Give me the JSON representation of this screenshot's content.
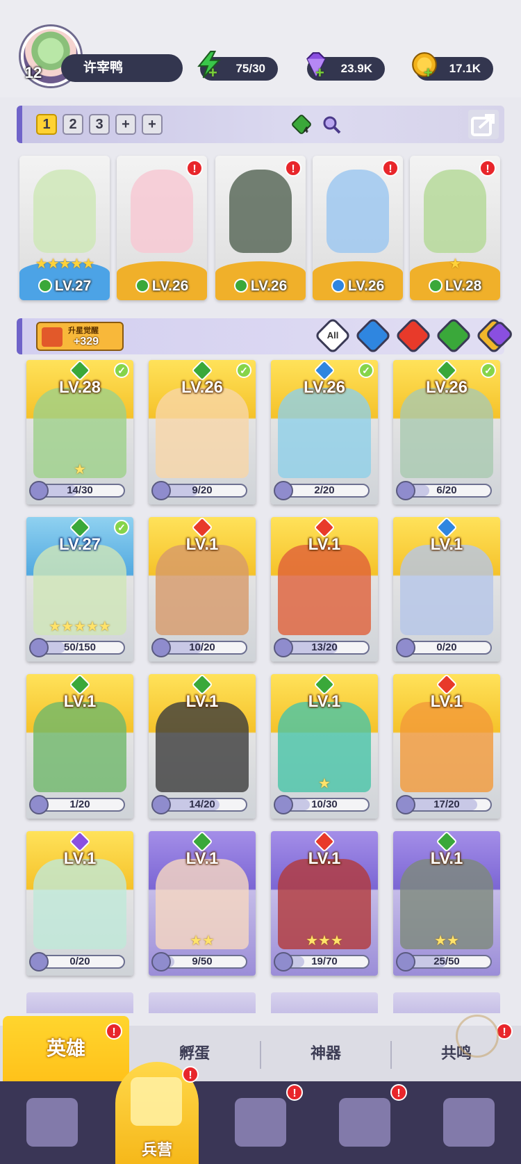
{
  "player": {
    "level": "12",
    "name": "许宰鸭"
  },
  "resources": [
    {
      "name": "energy",
      "icon": "lightning-icon",
      "value": "75/30",
      "color": "#3ac84a"
    },
    {
      "name": "gems",
      "icon": "diamond-icon",
      "value": "23.9K",
      "color": "#8a4fe0"
    },
    {
      "name": "gold",
      "icon": "coin-icon",
      "value": "17.1K",
      "color": "#f2b21c"
    }
  ],
  "team_bar": {
    "slots": [
      "1",
      "2",
      "3",
      "+",
      "+"
    ],
    "gem_count": "4"
  },
  "team": [
    {
      "level": "LV.27",
      "element_color": "#3aa83a",
      "stars": "★★★★★",
      "base": "blue",
      "alert": false
    },
    {
      "level": "LV.26",
      "element_color": "#3aa83a",
      "stars": "",
      "base": "gold",
      "alert": true
    },
    {
      "level": "LV.26",
      "element_color": "#3aa83a",
      "stars": "",
      "base": "gold",
      "alert": true
    },
    {
      "level": "LV.26",
      "element_color": "#2f86e0",
      "stars": "",
      "base": "gold",
      "alert": true
    },
    {
      "level": "LV.28",
      "element_color": "#3aa83a",
      "stars": "★",
      "base": "gold",
      "alert": true
    }
  ],
  "filter": {
    "awaken_label": "升星觉醒",
    "awaken_value": "+329",
    "all_label": "All"
  },
  "heroes": [
    {
      "level": "LV.28",
      "progress": "14/30",
      "elem": "#3aa83a",
      "checked": true,
      "theme": "gold",
      "stars": "★"
    },
    {
      "level": "LV.26",
      "progress": "9/20",
      "elem": "#3aa83a",
      "checked": true,
      "theme": "gold",
      "stars": ""
    },
    {
      "level": "LV.26",
      "progress": "2/20",
      "elem": "#2f86e0",
      "checked": true,
      "theme": "gold",
      "stars": ""
    },
    {
      "level": "LV.26",
      "progress": "6/20",
      "elem": "#3aa83a",
      "checked": true,
      "theme": "gold",
      "stars": ""
    },
    {
      "level": "LV.27",
      "progress": "50/150",
      "elem": "#3aa83a",
      "checked": true,
      "theme": "blue",
      "stars": "★★★★★"
    },
    {
      "level": "LV.1",
      "progress": "10/20",
      "elem": "#e83a2a",
      "checked": false,
      "theme": "gold",
      "stars": ""
    },
    {
      "level": "LV.1",
      "progress": "13/20",
      "elem": "#e83a2a",
      "checked": false,
      "theme": "gold",
      "stars": ""
    },
    {
      "level": "LV.1",
      "progress": "0/20",
      "elem": "#2f86e0",
      "checked": false,
      "theme": "gold",
      "stars": ""
    },
    {
      "level": "LV.1",
      "progress": "1/20",
      "elem": "#3aa83a",
      "checked": false,
      "theme": "gold",
      "stars": ""
    },
    {
      "level": "LV.1",
      "progress": "14/20",
      "elem": "#3aa83a",
      "checked": false,
      "theme": "gold",
      "stars": ""
    },
    {
      "level": "LV.1",
      "progress": "10/30",
      "elem": "#3aa83a",
      "checked": false,
      "theme": "gold",
      "stars": "★"
    },
    {
      "level": "LV.1",
      "progress": "17/20",
      "elem": "#e83a2a",
      "checked": false,
      "theme": "gold",
      "stars": ""
    },
    {
      "level": "LV.1",
      "progress": "0/20",
      "elem": "#8a4fe0",
      "checked": false,
      "theme": "gold",
      "stars": ""
    },
    {
      "level": "LV.1",
      "progress": "9/50",
      "elem": "#3aa83a",
      "checked": false,
      "theme": "purple",
      "stars": "★★"
    },
    {
      "level": "LV.1",
      "progress": "19/70",
      "elem": "#e83a2a",
      "checked": false,
      "theme": "purple",
      "stars": "★★★"
    },
    {
      "level": "LV.1",
      "progress": "25/50",
      "elem": "#3aa83a",
      "checked": false,
      "theme": "purple",
      "stars": "★★"
    }
  ],
  "sub_tabs": [
    {
      "label": "英雄",
      "active": true,
      "alert": true
    },
    {
      "label": "孵蛋",
      "active": false,
      "alert": false
    },
    {
      "label": "神器",
      "active": false,
      "alert": false
    },
    {
      "label": "共鸣",
      "active": false,
      "alert": true
    }
  ],
  "bottom_nav": [
    {
      "label": "",
      "icon": "cards-icon",
      "active": false,
      "alert": false
    },
    {
      "label": "兵营",
      "icon": "helmet-icon",
      "active": true,
      "alert": true
    },
    {
      "label": "",
      "icon": "map-icon",
      "active": false,
      "alert": true
    },
    {
      "label": "",
      "icon": "castle-icon",
      "active": false,
      "alert": true
    },
    {
      "label": "",
      "icon": "mushroom-icon",
      "active": false,
      "alert": false
    }
  ]
}
